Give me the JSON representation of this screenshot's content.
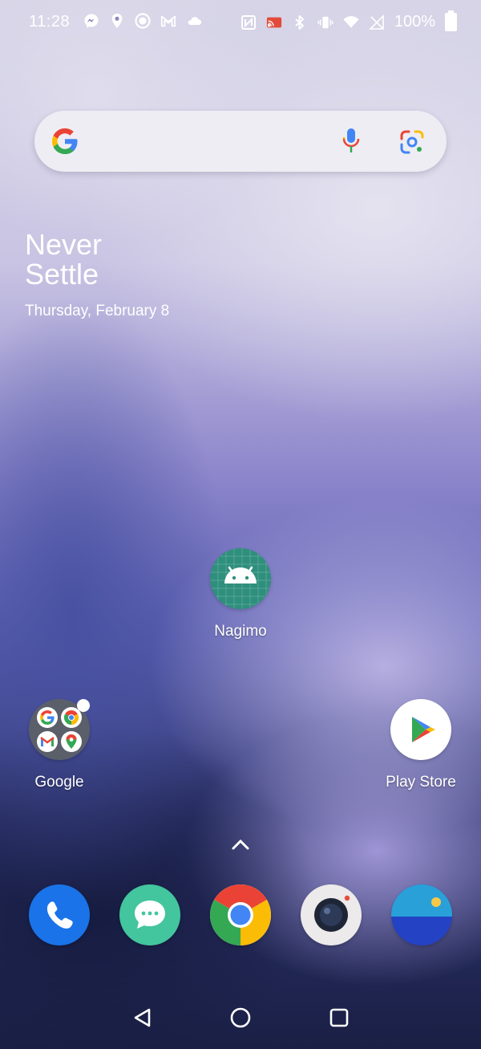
{
  "status_bar": {
    "time": "11:28",
    "left_icons": [
      "messenger-icon",
      "location-icon",
      "circle-icon",
      "gmail-icon",
      "cloud-icon"
    ],
    "right_icons": [
      "nfc-icon",
      "cast-icon",
      "bluetooth-icon",
      "vibrate-icon",
      "wifi-icon",
      "no-sim-icon"
    ],
    "battery": "100%"
  },
  "search": {
    "icons": [
      "google-g-icon",
      "microphone-icon",
      "google-lens-icon"
    ]
  },
  "clock_widget": {
    "line1": "Never",
    "line2": "Settle",
    "date": "Thursday, February 8"
  },
  "apps": {
    "nagimo": {
      "label": "Nagimo",
      "icon": "android-icon"
    },
    "google_folder": {
      "label": "Google",
      "icon": "folder-icon"
    },
    "play_store": {
      "label": "Play Store",
      "icon": "play-store-icon"
    }
  },
  "dock": [
    "phone-icon",
    "messages-icon",
    "chrome-icon",
    "camera-icon",
    "weather-icon"
  ],
  "nav": [
    "back-icon",
    "home-icon",
    "recents-icon"
  ],
  "colors": {
    "google_blue": "#4285F4",
    "google_red": "#EA4335",
    "google_yellow": "#FBBC05",
    "google_green": "#34A853",
    "nagimo_teal": "#2f8f7d",
    "phone_blue": "#1a73e8",
    "messages_teal": "#43c59e"
  }
}
